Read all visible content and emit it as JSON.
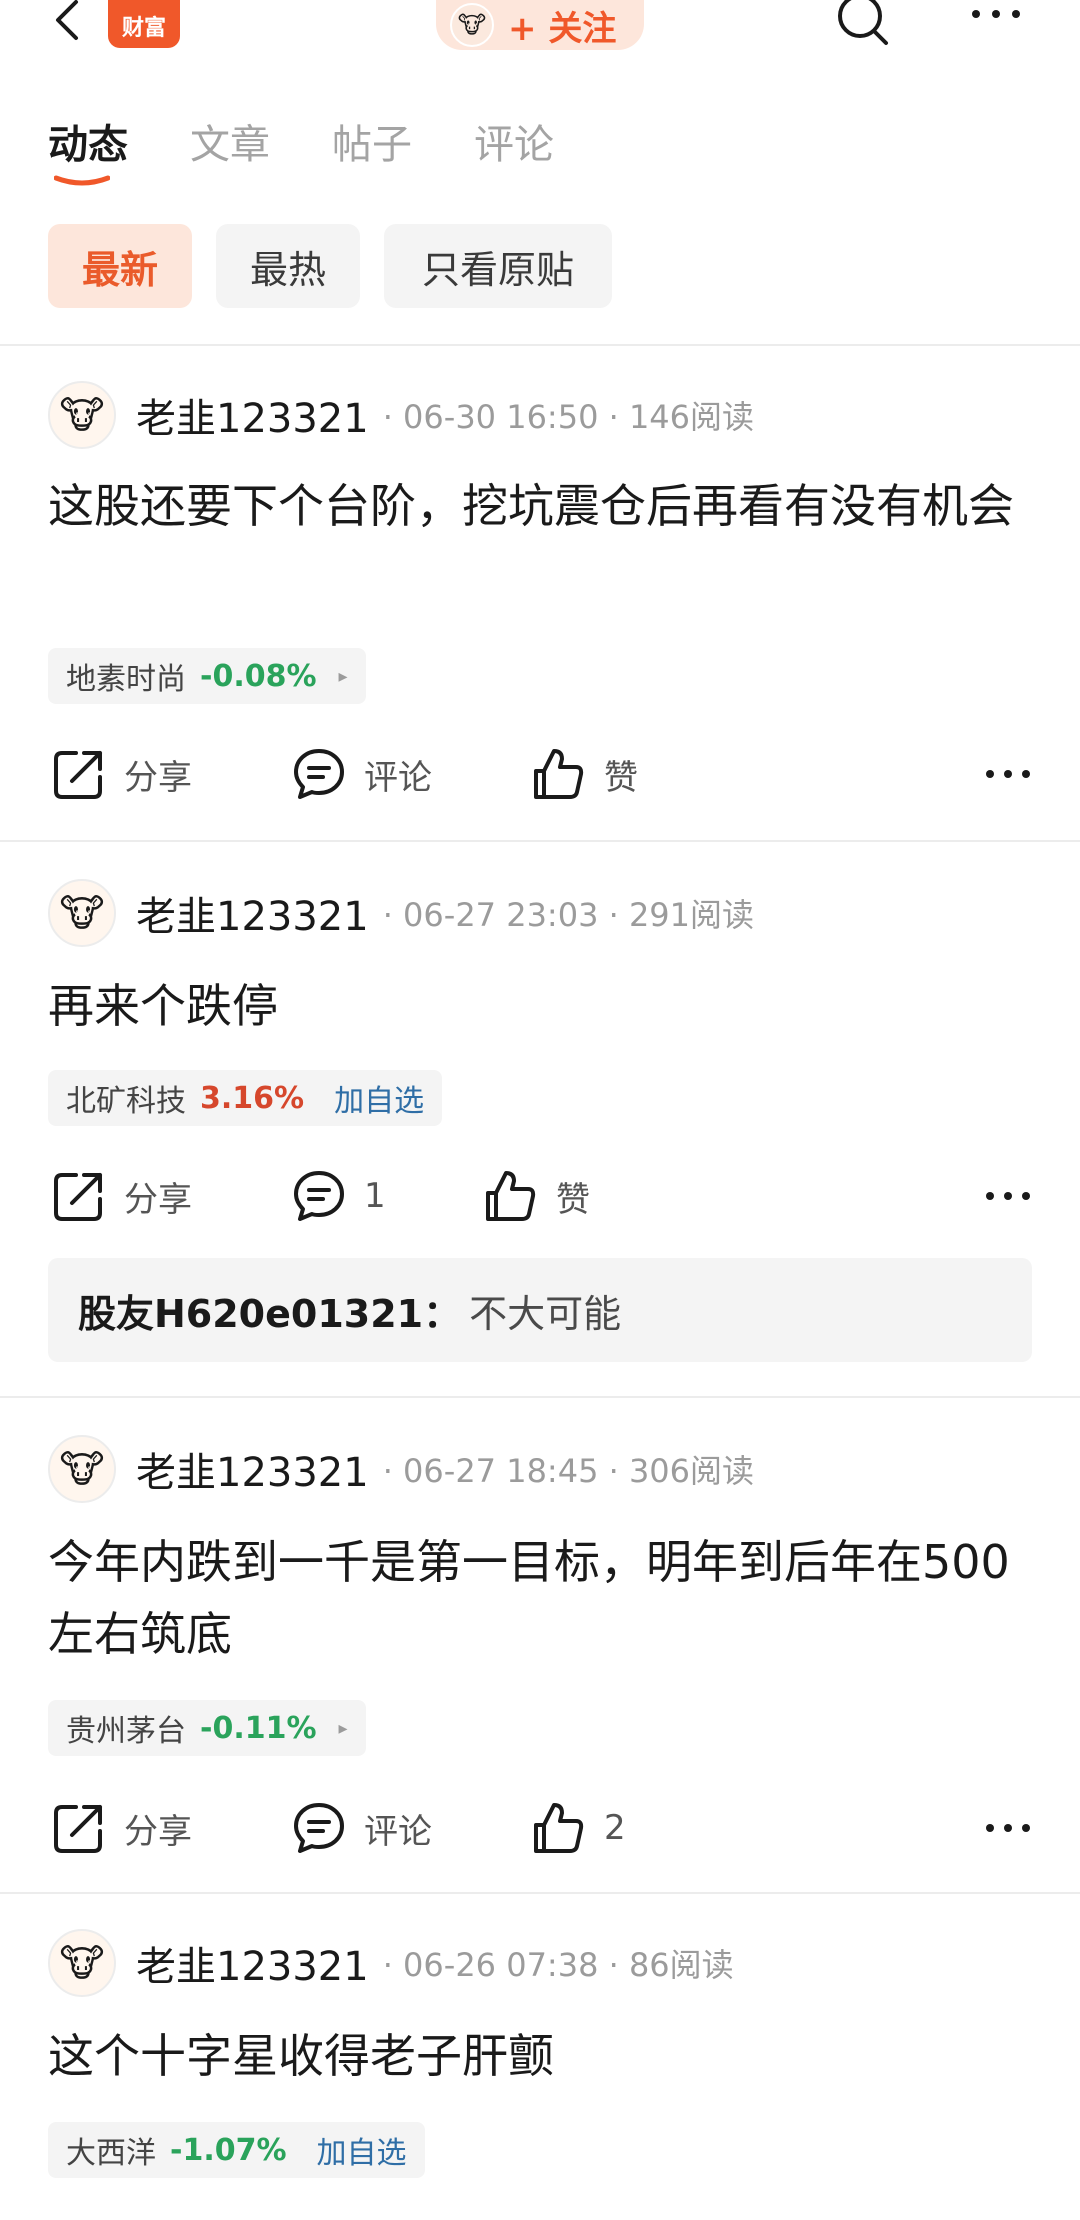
{
  "header": {
    "logo_text": "财富",
    "follow_label": "+ 关注",
    "icons": [
      "back-icon",
      "search-icon",
      "more-icon"
    ]
  },
  "tabs": [
    {
      "label": "动态",
      "active": true
    },
    {
      "label": "文章",
      "active": false
    },
    {
      "label": "帖子",
      "active": false
    },
    {
      "label": "评论",
      "active": false
    }
  ],
  "filters": [
    {
      "label": "最新",
      "active": true
    },
    {
      "label": "最热",
      "active": false
    },
    {
      "label": "只看原贴",
      "active": false
    }
  ],
  "posts": [
    {
      "author": "老韭123321",
      "meta": "· 06-30 16:50 · 146阅读",
      "text": "这股还要下个台阶，挖坑震仓后再看有没有机会",
      "stock": {
        "name": "地素时尚",
        "change": "-0.08%",
        "trend": "down",
        "arrow": "▸"
      },
      "share_label": "分享",
      "comment_label": "评论",
      "like_label": "赞"
    },
    {
      "author": "老韭123321",
      "meta": "· 06-27 23:03 · 291阅读",
      "text": "再来个跌停",
      "stock": {
        "name": "北矿科技",
        "change": "3.16%",
        "trend": "up",
        "add_label": "加自选"
      },
      "share_label": "分享",
      "comment_label": "1",
      "like_label": "赞",
      "reply": {
        "author": "股友H620e01321：",
        "text": "不大可能"
      }
    },
    {
      "author": "老韭123321",
      "meta": "· 06-27 18:45 · 306阅读",
      "text": "今年内跌到一千是第一目标，明年到后年在500左右筑底",
      "stock": {
        "name": "贵州茅台",
        "change": "-0.11%",
        "trend": "down",
        "arrow": "▸"
      },
      "share_label": "分享",
      "comment_label": "评论",
      "like_label": "2"
    },
    {
      "author": "老韭123321",
      "meta": "· 06-26 07:38 · 86阅读",
      "text": "这个十字星收得老子肝颤",
      "stock": {
        "name": "大西洋",
        "change": "-1.07%",
        "trend": "down",
        "add_label": "加自选"
      }
    }
  ],
  "colors": {
    "accent": "#f0582a",
    "up": "#d6472c",
    "down": "#2aa35b",
    "link": "#2f6ea6"
  }
}
